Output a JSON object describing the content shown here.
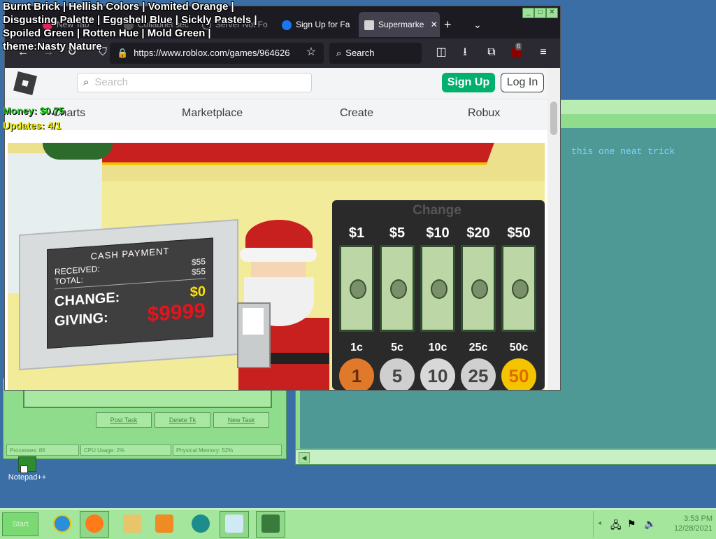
{
  "overlay": {
    "theme_line1": "Burnt Brick | Hellish Colors | Vomited Orange |",
    "theme_line2": "Disgusting Palette | Eggshell Blue | Sickly Pastels |",
    "theme_line3": "Spoiled Green | Rotten Hue | Mold Green |",
    "theme_line4": "theme:Nasty Nature",
    "money": "Money: $0.75",
    "updates": "Updates: 4/1"
  },
  "browser": {
    "tabs": [
      {
        "label": "New Tab"
      },
      {
        "label": "Collabnet sec"
      },
      {
        "label": "Server Not Fo"
      },
      {
        "label": "Sign Up for Fa"
      },
      {
        "label": "Supermarke"
      }
    ],
    "url": "https://www.roblox.com/games/964626",
    "search_label": "Search",
    "extension_badge": "6"
  },
  "roblox": {
    "search_placeholder": "Search",
    "signup_label": "Sign Up",
    "login_label": "Log In",
    "nav": [
      "Charts",
      "Marketplace",
      "Create",
      "Robux"
    ]
  },
  "game": {
    "cash_payment": {
      "title": "CASH   PAYMENT",
      "received_label": "RECEIVED:",
      "received_value": "$55",
      "total_label": "TOTAL:",
      "total_value": "$55",
      "change_label": "CHANGE:",
      "change_value": "$0",
      "giving_label": "GIVING:",
      "giving_value": "$9999"
    },
    "change_panel": {
      "title": "Change",
      "bills": [
        "$1",
        "$5",
        "$10",
        "$20",
        "$50"
      ],
      "coins": [
        "1c",
        "5c",
        "10c",
        "25c",
        "50c"
      ],
      "coin_faces": [
        "1",
        "5",
        "10",
        "25",
        "50"
      ]
    }
  },
  "background_window": {
    "text": "this one neat trick",
    "buttons": [
      "Post Task",
      "Delete Tk",
      "New Task"
    ],
    "status": [
      "Processes: 86",
      "CPU Usage: 2%",
      "Physical Memory: 52%"
    ]
  },
  "desktop": {
    "icon_label": "Notepad++"
  },
  "taskbar": {
    "start_label": "Start",
    "clock_time": "3:53 PM",
    "clock_date": "12/28/2021"
  },
  "colors": {
    "roblox_green": "#00b06f",
    "theme_green": "#a3e69c",
    "desktop_blue": "#3a6ea5"
  }
}
